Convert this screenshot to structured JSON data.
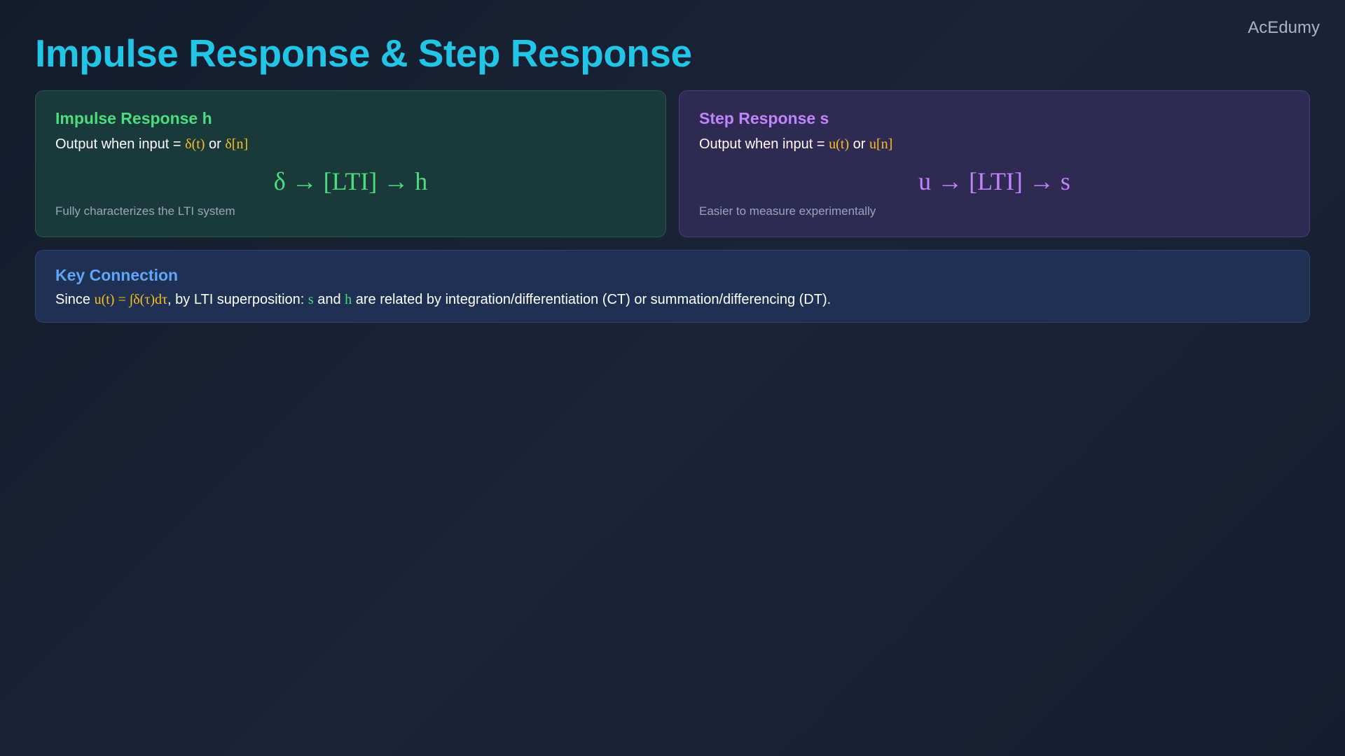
{
  "brand": "AcEdumy",
  "title": "Impulse Response & Step Response",
  "impulse": {
    "title": "Impulse Response h",
    "desc_prefix": "Output when input = ",
    "input_ct": "δ(t)",
    "or": " or ",
    "input_dt": "δ[n]",
    "formula": "δ → [LTI] → h",
    "note": "Fully characterizes the LTI system"
  },
  "step": {
    "title": "Step Response s",
    "desc_prefix": "Output when input = ",
    "input_ct": "u(t)",
    "or": " or ",
    "input_dt": "u[n]",
    "formula": "u → [LTI] → s",
    "note": "Easier to measure experimentally"
  },
  "key": {
    "title": "Key Connection",
    "since": "Since ",
    "eq": "u(t) = ∫δ(τ)dτ",
    "mid": ", by LTI superposition: ",
    "s": "s",
    "and": " and ",
    "h": "h",
    "rest": " are related by integration/differentiation (CT) or summation/differencing (DT)."
  }
}
